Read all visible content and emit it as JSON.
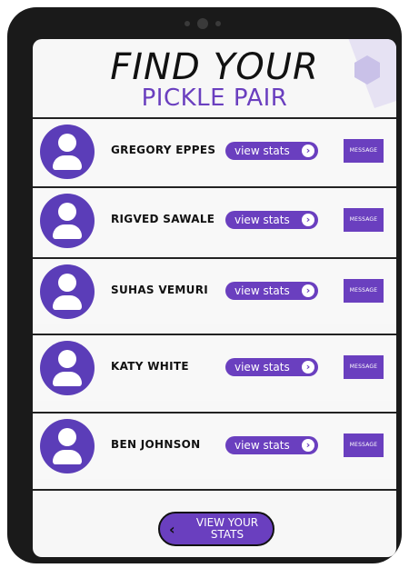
{
  "header": {
    "title_line1": "FIND YOUR",
    "title_line2": "PICKLE PAIR"
  },
  "players": [
    {
      "name": "GREGORY EPPES",
      "stats_label": "view stats",
      "message_label": "MESSAGE"
    },
    {
      "name": "RIGVED SAWALE",
      "stats_label": "view stats",
      "message_label": "MESSAGE"
    },
    {
      "name": "SUHAS VEMURI",
      "stats_label": "view stats",
      "message_label": "MESSAGE"
    },
    {
      "name": "KATY WHITE",
      "stats_label": "view stats",
      "message_label": "MESSAGE"
    },
    {
      "name": "BEN JOHNSON",
      "stats_label": "view stats",
      "message_label": "MESSAGE"
    }
  ],
  "footer": {
    "view_your_stats_line1": "VIEW YOUR",
    "view_your_stats_line2": "STATS"
  },
  "icons": {
    "avatar": "user-avatar-icon",
    "stats_arrow": "chevron-right-circle-icon",
    "back": "chevron-left-icon"
  },
  "colors": {
    "accent": "#6a3fbf",
    "avatar": "#5b3db8",
    "frame": "#1a1a1a"
  }
}
